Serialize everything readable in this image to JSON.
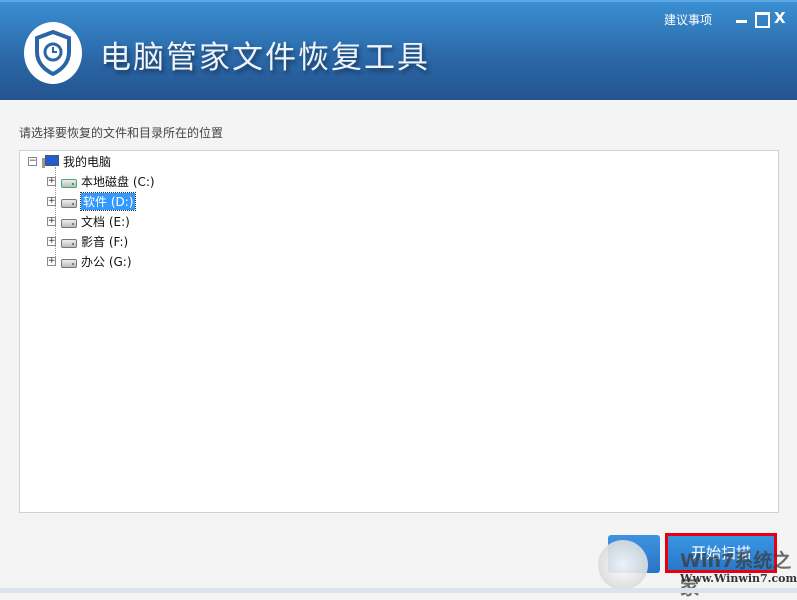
{
  "header": {
    "title": "电脑管家文件恢复工具",
    "suggest_link": "建议事项",
    "minimize_label": "",
    "close_label": "X"
  },
  "prompt": "请选择要恢复的文件和目录所在的位置",
  "tree": {
    "root": "我的电脑",
    "drives": [
      {
        "label": "本地磁盘 (C:)",
        "icon": "system-drive-icon"
      },
      {
        "label": "软件 (D:)",
        "icon": "drive-icon",
        "selected": true
      },
      {
        "label": "文档 (E:)",
        "icon": "drive-icon"
      },
      {
        "label": "影音 (F:)",
        "icon": "drive-icon"
      },
      {
        "label": "办公 (G:)",
        "icon": "drive-icon"
      }
    ]
  },
  "buttons": {
    "start_scan": "开始扫描"
  },
  "watermark": {
    "text": "Win7系统之家",
    "url": "Www.Winwin7.com"
  },
  "colors": {
    "header": "#2a66a6",
    "selection": "#3399ff",
    "highlight_border": "#e60012"
  }
}
